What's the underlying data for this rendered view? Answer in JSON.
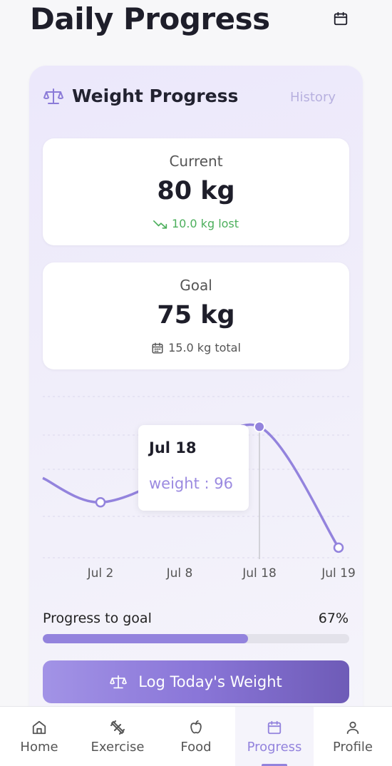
{
  "header": {
    "title": "Daily Progress"
  },
  "card": {
    "title": "Weight Progress",
    "history_label": "History",
    "current": {
      "label": "Current",
      "value": "80 kg",
      "sub": "10.0 kg lost"
    },
    "goal": {
      "label": "Goal",
      "value": "75 kg",
      "sub": "15.0 kg total"
    },
    "progress": {
      "label": "Progress to goal",
      "percent_text": "67%",
      "fraction": 0.67
    },
    "log_button": "Log Today's Weight"
  },
  "tooltip": {
    "date": "Jul 18",
    "text": "weight : 96"
  },
  "chart_data": {
    "type": "line",
    "categories": [
      "Jul 2",
      "Jul 8",
      "Jul 18",
      "Jul 19"
    ],
    "series": [
      {
        "values": [
          86,
          90,
          96,
          80
        ]
      }
    ],
    "ylim": [
      78,
      100
    ],
    "grid": true,
    "active_index": 2,
    "line_color": "#9383dd"
  },
  "nav": {
    "items": [
      {
        "label": "Home",
        "icon": "home-icon"
      },
      {
        "label": "Exercise",
        "icon": "dumbbell-icon"
      },
      {
        "label": "Food",
        "icon": "apple-icon"
      },
      {
        "label": "Progress",
        "icon": "calendar-icon",
        "active": true
      },
      {
        "label": "Profile",
        "icon": "user-icon"
      }
    ]
  },
  "colors": {
    "accent": "#9383dd",
    "success": "#4caf5c",
    "card_bg": "#ece8fb"
  }
}
